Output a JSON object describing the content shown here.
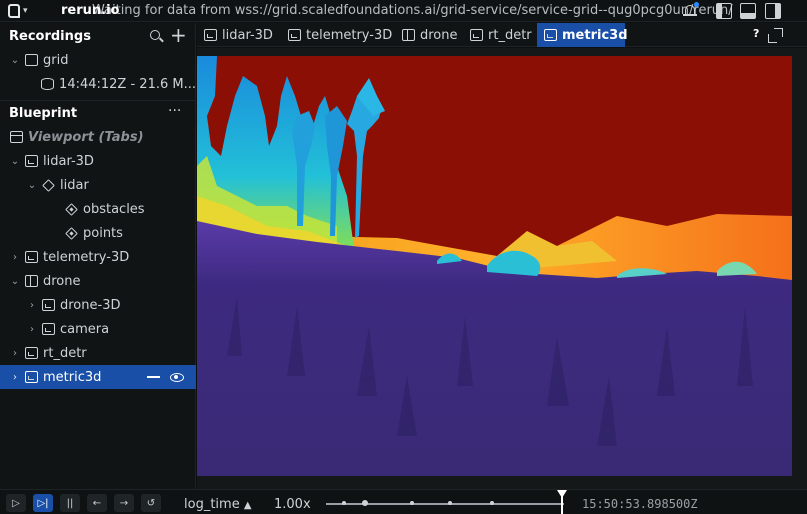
{
  "app": {
    "name": "rerun.io",
    "status_text": "Waiting for data from wss://grid.scaledfoundations.ai/grid-service/service-grid--qug0pcg0un/rerun/"
  },
  "recordings": {
    "title": "Recordings",
    "app_id": "grid",
    "entry": "14:44:12Z - 21.6 M..."
  },
  "blueprint": {
    "title": "Blueprint",
    "items": [
      {
        "label": "Viewport (Tabs)"
      },
      {
        "label": "lidar-3D"
      },
      {
        "label": "lidar"
      },
      {
        "label": "obstacles"
      },
      {
        "label": "points"
      },
      {
        "label": "telemetry-3D"
      },
      {
        "label": "drone"
      },
      {
        "label": "drone-3D"
      },
      {
        "label": "camera"
      },
      {
        "label": "rt_detr"
      },
      {
        "label": "metric3d"
      }
    ]
  },
  "tabs": [
    {
      "label": "lidar-3D"
    },
    {
      "label": "telemetry-3D"
    },
    {
      "label": "drone"
    },
    {
      "label": "rt_detr"
    },
    {
      "label": "metric3d",
      "active": true
    }
  ],
  "help_label": "?",
  "time_panel": {
    "timeline": "log_time",
    "speed": "1.00x",
    "timestamp": "15:50:53.898500Z"
  },
  "colors": {
    "accent": "#1a4fa8",
    "sky_depth": "#8b0f05",
    "ground_depth": "#3a2a78"
  }
}
